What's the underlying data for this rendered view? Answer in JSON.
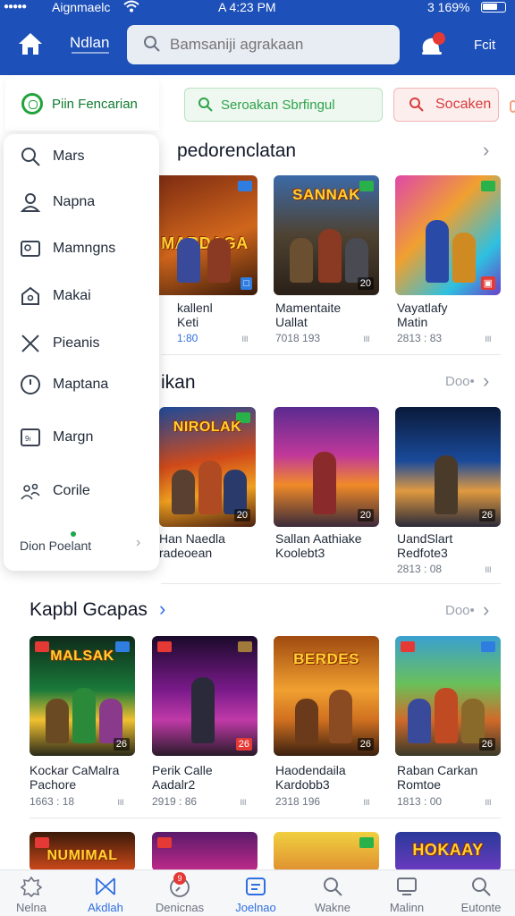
{
  "status_bar": {
    "carrier": "Aignmaelc",
    "time": "A 4:23 PM",
    "battery_text": "3 169%",
    "battery_level": 0.69
  },
  "header": {
    "brand": "Ndlan",
    "search_placeholder": "Bamsaniji agrakaan",
    "right_label": "Fcit"
  },
  "toolbar": {
    "green_chip": "Seroakan Sbrfingul",
    "red_chip": "Socaken"
  },
  "side_panel": {
    "header": "Piin Fencarian",
    "items": [
      {
        "label": "Mars",
        "icon": "search-icon"
      },
      {
        "label": "Napna",
        "icon": "user-icon"
      },
      {
        "label": "Mamngns",
        "icon": "id-card-icon"
      },
      {
        "label": "Makai",
        "icon": "home-icon"
      },
      {
        "label": "Pieanis",
        "icon": "cross-swords-icon"
      },
      {
        "label": "Maptana",
        "icon": "clock-icon"
      },
      {
        "label": "Margn",
        "icon": "calendar-icon"
      },
      {
        "label": "Corile",
        "icon": "group-icon"
      }
    ],
    "footer": "Dion Poelant"
  },
  "sections": [
    {
      "title": "pedorenclatan",
      "more": "",
      "games": [
        {
          "title": "kallenl\nKeti",
          "meta": "1:80",
          "meta_blue": true,
          "logo": "MARDAGA",
          "art": "orange"
        },
        {
          "title": "Mamentaite\nUallat",
          "meta": "7018 193",
          "meta_blue": false,
          "logo": "SANNAK",
          "art": "blue"
        },
        {
          "title": "Vayatlafy\nMatin",
          "meta": "2813 : 83",
          "meta_blue": false,
          "logo": "",
          "art": "rainbow"
        }
      ]
    },
    {
      "title": "ikan",
      "more": "Doo",
      "games": [
        {
          "title": "Han Naedla\nradeoean",
          "meta": "",
          "meta_blue": false,
          "logo": "NIROLAK",
          "art": "fire"
        },
        {
          "title": "Sallan Aathiake\nKoolebt3",
          "meta": "",
          "meta_blue": false,
          "logo": "",
          "art": "purple"
        },
        {
          "title": "UandSlart\nRedfote3",
          "meta": "2813 : 08",
          "meta_blue": false,
          "logo": "",
          "art": "dark"
        }
      ]
    },
    {
      "title": "Kapbl Gcapas",
      "more": "Doo",
      "games": [
        {
          "title": "Kockar CaMalra\nPachore",
          "meta": "1663 : 18",
          "meta_blue": false,
          "logo": "MALSAK",
          "art": "green"
        },
        {
          "title": "Perik Calle\nAadalr2",
          "meta": "2919 : 86",
          "meta_blue": false,
          "logo": "",
          "art": "violet"
        },
        {
          "title": "Haodendaila\nKardobb3",
          "meta": "2318 196",
          "meta_blue": false,
          "logo": "BERDES",
          "art": "amber"
        },
        {
          "title": "Raban Carkan\nRomtoe",
          "meta": "1813 : 00",
          "meta_blue": false,
          "logo": "",
          "art": "teal"
        }
      ]
    },
    {
      "title": "",
      "more": "",
      "games": [
        {
          "logo": "NUMIMAL",
          "art": "fire"
        },
        {
          "logo": "",
          "art": "violet"
        },
        {
          "logo": "",
          "art": "amber"
        },
        {
          "logo": "HOKAAY",
          "art": "blue"
        }
      ]
    }
  ],
  "tags": {
    "s1": [
      "",
      "20",
      ""
    ],
    "s2": [
      "20",
      "20",
      "26"
    ],
    "s3": [
      "26",
      "26",
      "26",
      "26"
    ]
  },
  "tabbar": [
    {
      "label": "Nelna",
      "icon": "gear-icon",
      "active": false
    },
    {
      "label": "Akdlah",
      "icon": "bowtie-icon",
      "active": false
    },
    {
      "label": "Denicnas",
      "icon": "compass-icon",
      "active": false,
      "badge": "9"
    },
    {
      "label": "Joelnao",
      "icon": "note-icon",
      "active": true
    },
    {
      "label": "Wakne",
      "icon": "search-icon",
      "active": false
    },
    {
      "label": "Malinn",
      "icon": "monitor-icon",
      "active": false
    },
    {
      "label": "Eutonte",
      "icon": "search-alt-icon",
      "active": false
    }
  ],
  "colors": {
    "primary": "#1d50b8",
    "green": "#2ea24a",
    "red": "#d83c3c",
    "accent_blue": "#2f6fe0"
  }
}
